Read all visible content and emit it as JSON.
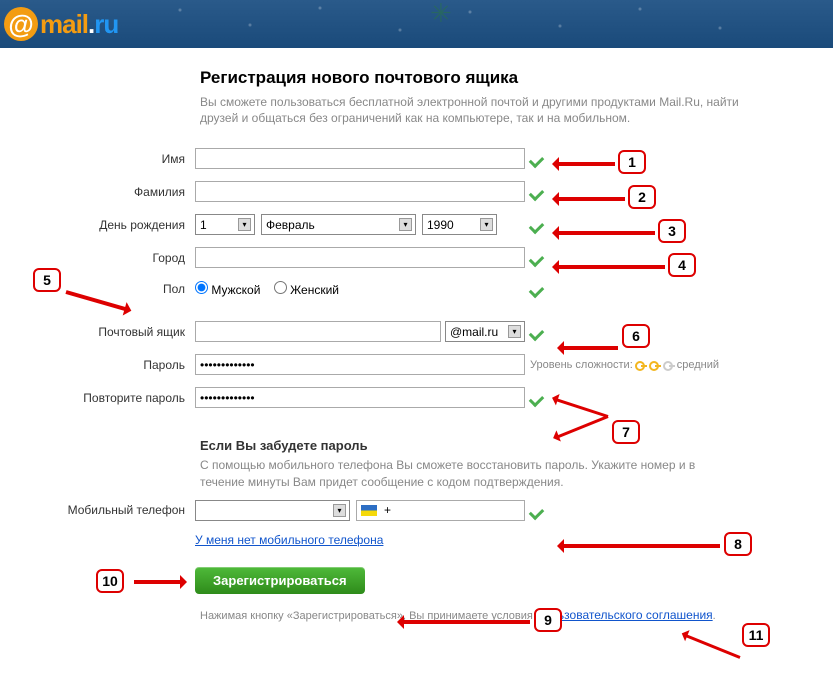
{
  "logo": {
    "mail": "mail",
    "ru": "ru"
  },
  "intro": {
    "title": "Регистрация нового почтового ящика",
    "text": "Вы сможете пользоваться бесплатной электронной почтой и другими продуктами Mail.Ru, найти друзей и общаться без ограничений как на компьютере, так и на мобильном."
  },
  "labels": {
    "name": "Имя",
    "surname": "Фамилия",
    "dob": "День рождения",
    "city": "Город",
    "gender": "Пол",
    "mailbox": "Почтовый ящик",
    "password": "Пароль",
    "password2": "Повторите пароль",
    "mobile": "Мобильный телефон"
  },
  "values": {
    "name": "",
    "surname": "",
    "dob_day": "1",
    "dob_month": "Февраль",
    "dob_year": "1990",
    "city": "",
    "gender_male": "Мужской",
    "gender_female": "Женский",
    "mailbox_value": "",
    "mailbox_domain": "@mail.ru",
    "password": "•••••••••••••",
    "password2": "•••••••••••••",
    "mobile_country": "",
    "mobile_number": "+"
  },
  "gender_selected": "male",
  "password_strength": {
    "label": "Уровень сложности:",
    "level": "средний"
  },
  "recover": {
    "title": "Если Вы забудете пароль",
    "text": "С помощью мобильного телефона Вы сможете восстановить пароль. Укажите номер и в течение минуты Вам придет сообщение с кодом подтверждения."
  },
  "no_mobile_link": "У меня нет мобильного телефона",
  "register_btn": "Зарегистрироваться",
  "footer": {
    "pre": "Нажимая кнопку «Зарегистрироваться», Вы принимаете условия ",
    "link": "Пользовательского соглашения",
    "post": "."
  },
  "callouts": {
    "1": "1",
    "2": "2",
    "3": "3",
    "4": "4",
    "5": "5",
    "6": "6",
    "7": "7",
    "8": "8",
    "9": "9",
    "10": "10",
    "11": "11"
  }
}
